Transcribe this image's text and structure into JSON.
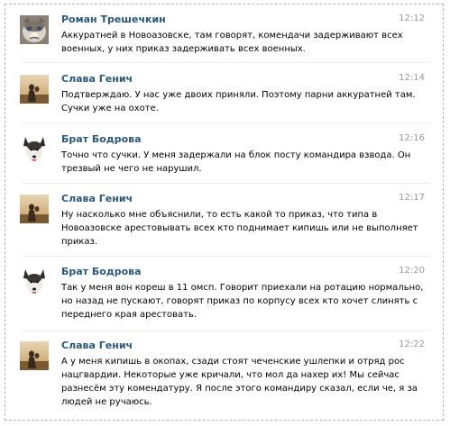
{
  "messages": [
    {
      "author": "Роман Трешечкин",
      "time": "12:12",
      "text": "Аккуратней в Новоазовске, там говорят, комендачи задерживают всех военных, у них приказ задерживать всех военных.",
      "avatar": "cat-avatar"
    },
    {
      "author": "Слава Генич",
      "time": "12:14",
      "text": "Подтверждаю. У нас уже двоих приняли. Поэтому парни аккуратней там. Сучки уже на охоте.",
      "avatar": "sunset-avatar"
    },
    {
      "author": "Брат Бодрова",
      "time": "12:16",
      "text": "Точно что сучки. У меня задержали на блок посту командира взвода. Он трезвый не чего не нарушил.",
      "avatar": "dog-avatar"
    },
    {
      "author": "Слава Генич",
      "time": "12:17",
      "text": "Ну насколько мне объяснили, то есть какой то приказ, что типа в Новоазовске арестовывать всех кто поднимает кипишь или не выполняет приказ.",
      "avatar": "sunset-avatar"
    },
    {
      "author": "Брат Бодрова",
      "time": "12:20",
      "text": "Так у меня вон кореш в 11 омсп. Говорит приехали на ротацию нормально, но назад не пускают, говорят приказ по корпусу всех кто хочет слинять с переднего края арестовать.",
      "avatar": "dog-avatar"
    },
    {
      "author": "Слава Генич",
      "time": "12:22",
      "text": "А у меня кипишь в окопах, сзади стоят чеченские ушлепки и отряд рос нацгвардии. Некоторые уже кричали, что мол да нахер их! Мы сейчас разнесём эту комендатуру. Я после этого командиру сказал, если че, я за людей не ручаюсь.",
      "avatar": "sunset-avatar"
    }
  ],
  "colors": {
    "author": "#2b587a",
    "time": "#999999",
    "text": "#000000",
    "separator": "#e9ecf0"
  }
}
